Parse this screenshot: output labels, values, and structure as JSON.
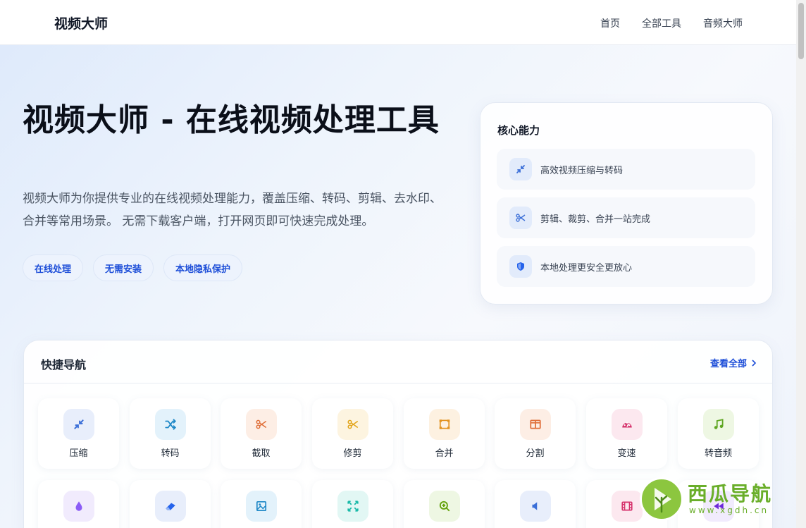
{
  "header": {
    "brand": "视频大师",
    "nav": [
      "首页",
      "全部工具",
      "音频大师"
    ]
  },
  "hero": {
    "title": "视频大师 - 在线视频处理工具",
    "description": "视频大师为你提供专业的在线视频处理能力，覆盖压缩、转码、剪辑、去水印、合并等常用场景。 无需下载客户端，打开网页即可快速完成处理。",
    "tags": [
      "在线处理",
      "无需安装",
      "本地隐私保护"
    ]
  },
  "core": {
    "title": "核心能力",
    "items": [
      {
        "text": "高效视频压缩与转码",
        "icon": "compress-icon"
      },
      {
        "text": "剪辑、裁剪、合并一站完成",
        "icon": "scissors-icon"
      },
      {
        "text": "本地处理更安全更放心",
        "icon": "shield-icon"
      }
    ]
  },
  "quick": {
    "title": "快捷导航",
    "view_all": "查看全部",
    "row1": [
      {
        "label": "压缩",
        "icon": "compress-icon",
        "color": "#3b6fd8",
        "bg": "#e8eefb"
      },
      {
        "label": "转码",
        "icon": "shuffle-icon",
        "color": "#1e88c7",
        "bg": "#e3f2fb"
      },
      {
        "label": "截取",
        "icon": "scissors-icon",
        "color": "#e0713c",
        "bg": "#fdeee5"
      },
      {
        "label": "修剪",
        "icon": "scissors-icon",
        "color": "#e2a51c",
        "bg": "#fdf4e0"
      },
      {
        "label": "合并",
        "icon": "merge-frame-icon",
        "color": "#e39320",
        "bg": "#fdf1e1"
      },
      {
        "label": "分割",
        "icon": "split-icon",
        "color": "#e0713c",
        "bg": "#fdeee5"
      },
      {
        "label": "变速",
        "icon": "speedometer-icon",
        "color": "#d6336c",
        "bg": "#fce8ef"
      },
      {
        "label": "转音频",
        "icon": "music-note-icon",
        "color": "#5fa622",
        "bg": "#eef7e3"
      }
    ],
    "row2": [
      {
        "icon": "drop-icon",
        "color": "#8b5cf6",
        "bg": "#f1ebfd"
      },
      {
        "icon": "eraser-icon",
        "color": "#2563eb",
        "bg": "#e8eefb"
      },
      {
        "icon": "image-icon",
        "color": "#1e88c7",
        "bg": "#e3f2fb"
      },
      {
        "icon": "expand-icon",
        "color": "#14b8a6",
        "bg": "#e2f7f4"
      },
      {
        "icon": "zoom-in-icon",
        "color": "#65a30d",
        "bg": "#eef7e3"
      },
      {
        "icon": "volume-icon",
        "color": "#3b6fd8",
        "bg": "#e8eefb"
      },
      {
        "icon": "film-icon",
        "color": "#d6336c",
        "bg": "#fce8ef"
      },
      {
        "icon": "rewind-icon",
        "color": "#6d28d9",
        "bg": "#f1ebfd"
      }
    ]
  },
  "watermark": {
    "name": "西瓜导航",
    "url": "www.xgdh.cn"
  }
}
